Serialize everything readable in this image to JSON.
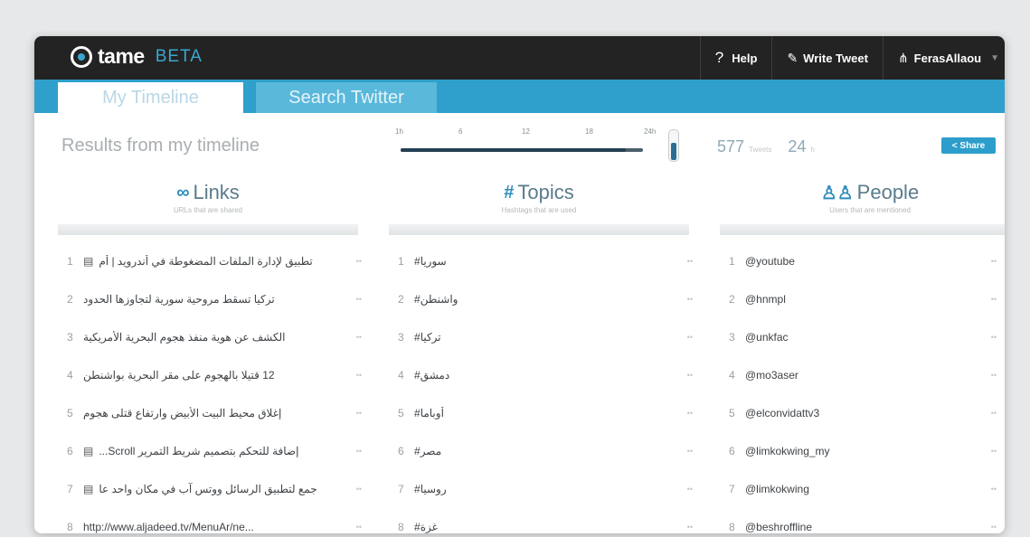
{
  "app": {
    "name": "tame",
    "badge": "BETA"
  },
  "nav": {
    "help_label": "Help",
    "write_tweet_label": "Write Tweet",
    "user_label": "FerasAllaou"
  },
  "tabs": [
    {
      "label": "My Timeline",
      "active": true
    },
    {
      "label": "Search Twitter",
      "active": false
    }
  ],
  "results": {
    "label": "Results from my timeline"
  },
  "slider": {
    "ticks": [
      "1h",
      "6",
      "12",
      "18",
      "24h"
    ],
    "value_fraction": 0.93
  },
  "stats": {
    "tweets": "577",
    "tweets_unit": "Tweets",
    "hours": "24",
    "hours_unit": "h"
  },
  "share_label": "< Share",
  "columns": {
    "links": {
      "title": "Links",
      "subtitle": "URLs that are shared",
      "icon": "link-icon",
      "rows": [
        {
          "num": "1",
          "text": "تطبيق لإدارة الملفات المضغوطة في أندرويد | أم",
          "doc": true
        },
        {
          "num": "2",
          "text": "تركيا تسقط مروحية سورية لتجاوزها الحدود",
          "doc": false
        },
        {
          "num": "3",
          "text": "الكشف عن هوية منفذ هجوم البحرية الأمريكية",
          "doc": false
        },
        {
          "num": "4",
          "text": "12 قتيلا بالهجوم على مقر البحرية بواشنطن",
          "doc": false
        },
        {
          "num": "5",
          "text": "إغلاق محيط البيت الأبيض وارتفاع قتلى هجوم",
          "doc": false
        },
        {
          "num": "6",
          "text": "إضافة للتحكم بتصميم شريط التمرير Scroll...",
          "doc": true
        },
        {
          "num": "7",
          "text": "جمع لتطبيق الرسائل ووتس آب في مكان واحد عا",
          "doc": true
        },
        {
          "num": "8",
          "text": "http://www.aljadeed.tv/MenuAr/ne...",
          "doc": false
        }
      ]
    },
    "topics": {
      "title": "Topics",
      "subtitle": "Hashtags that are used",
      "icon": "hashtag-icon",
      "rows": [
        {
          "num": "1",
          "text": "#سوريا"
        },
        {
          "num": "2",
          "text": "#واشنطن"
        },
        {
          "num": "3",
          "text": "#تركيا"
        },
        {
          "num": "4",
          "text": "#دمشق"
        },
        {
          "num": "5",
          "text": "#أوباما"
        },
        {
          "num": "6",
          "text": "#مصر"
        },
        {
          "num": "7",
          "text": "#روسيا"
        },
        {
          "num": "8",
          "text": "#غزة"
        }
      ]
    },
    "people": {
      "title": "People",
      "subtitle": "Users that are mentioned",
      "icon": "people-icon",
      "rows": [
        {
          "num": "1",
          "text": "@youtube"
        },
        {
          "num": "2",
          "text": "@hnmpl"
        },
        {
          "num": "3",
          "text": "@unkfac"
        },
        {
          "num": "4",
          "text": "@mo3aser"
        },
        {
          "num": "5",
          "text": "@elconvidattv3"
        },
        {
          "num": "6",
          "text": "@limkokwing_my"
        },
        {
          "num": "7",
          "text": "@limkokwing"
        },
        {
          "num": "8",
          "text": "@beshroffline"
        }
      ]
    }
  },
  "colors": {
    "accent": "#2ea0cb",
    "topbar": "#232323",
    "background": "#e6e8ea"
  }
}
